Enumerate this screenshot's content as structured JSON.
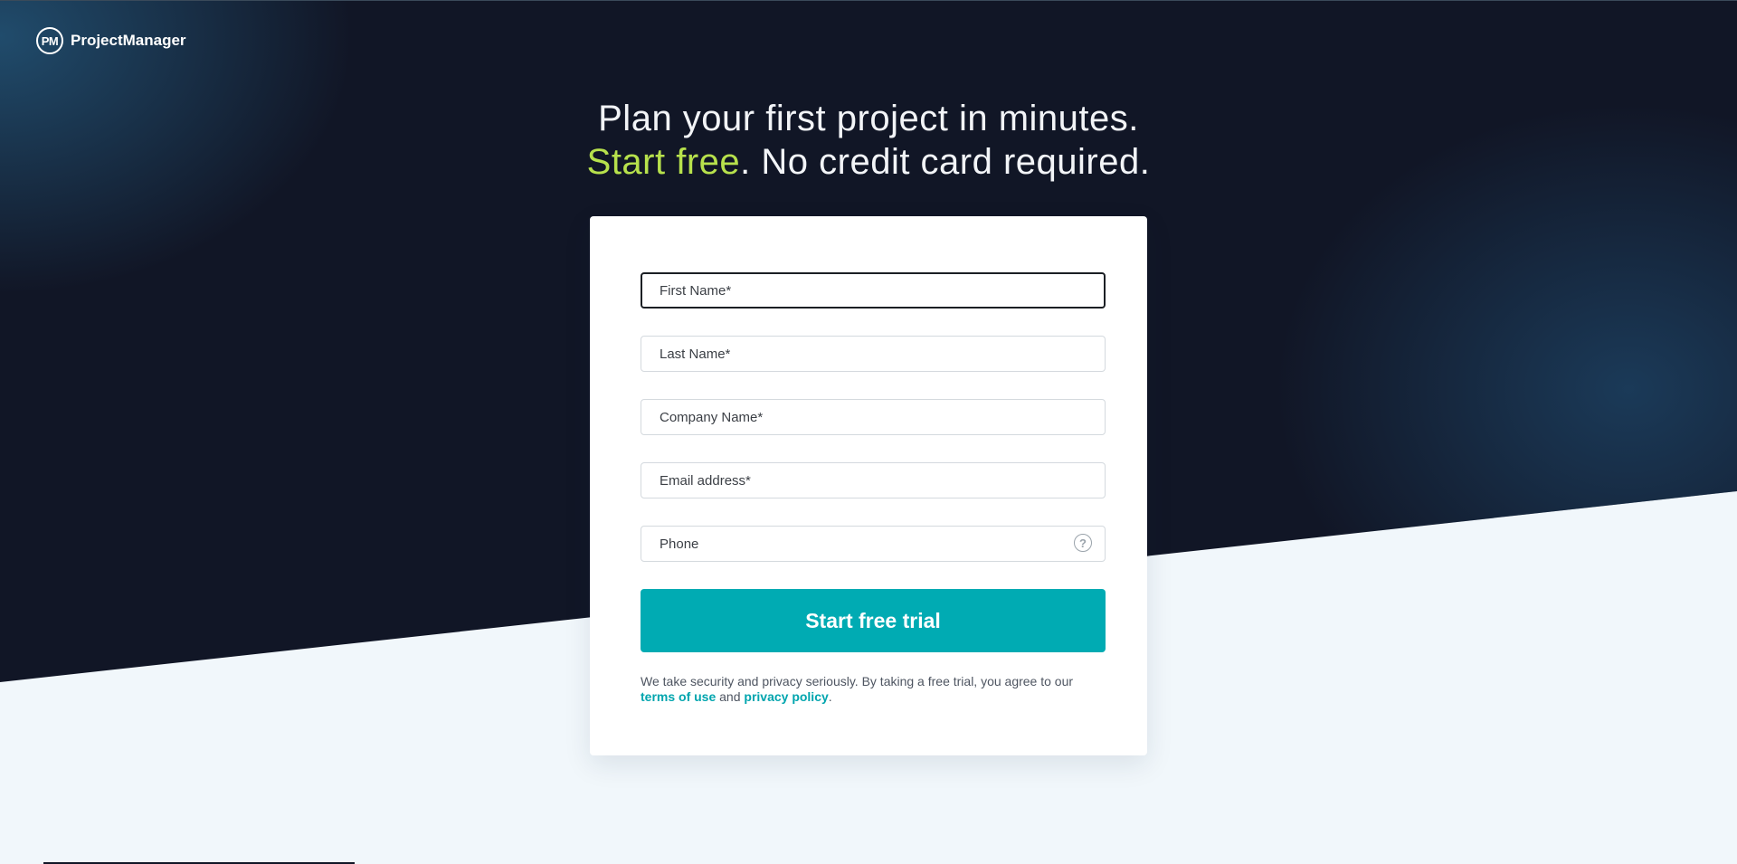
{
  "brand": {
    "logo_mark": "PM",
    "name": "ProjectManager"
  },
  "headline": {
    "line1": "Plan your first project in minutes.",
    "line2_accent": "Start free",
    "line2_rest": ". No credit card required."
  },
  "form": {
    "first_name_placeholder": "First Name*",
    "last_name_placeholder": "Last Name*",
    "company_placeholder": "Company Name*",
    "email_placeholder": "Email address*",
    "phone_placeholder": "Phone",
    "phone_help_icon": "?",
    "submit_label": "Start free trial"
  },
  "legal": {
    "text_before": "We take security and privacy seriously. By taking a free trial, you agree to our ",
    "terms_label": "terms of use",
    "text_middle": " and ",
    "privacy_label": "privacy policy",
    "text_after": "."
  },
  "colors": {
    "background_dark": "#111626",
    "background_light": "#f1f7fb",
    "accent_green": "#b7e14c",
    "button_teal": "#00abb3",
    "link_teal": "#00a5ae"
  }
}
